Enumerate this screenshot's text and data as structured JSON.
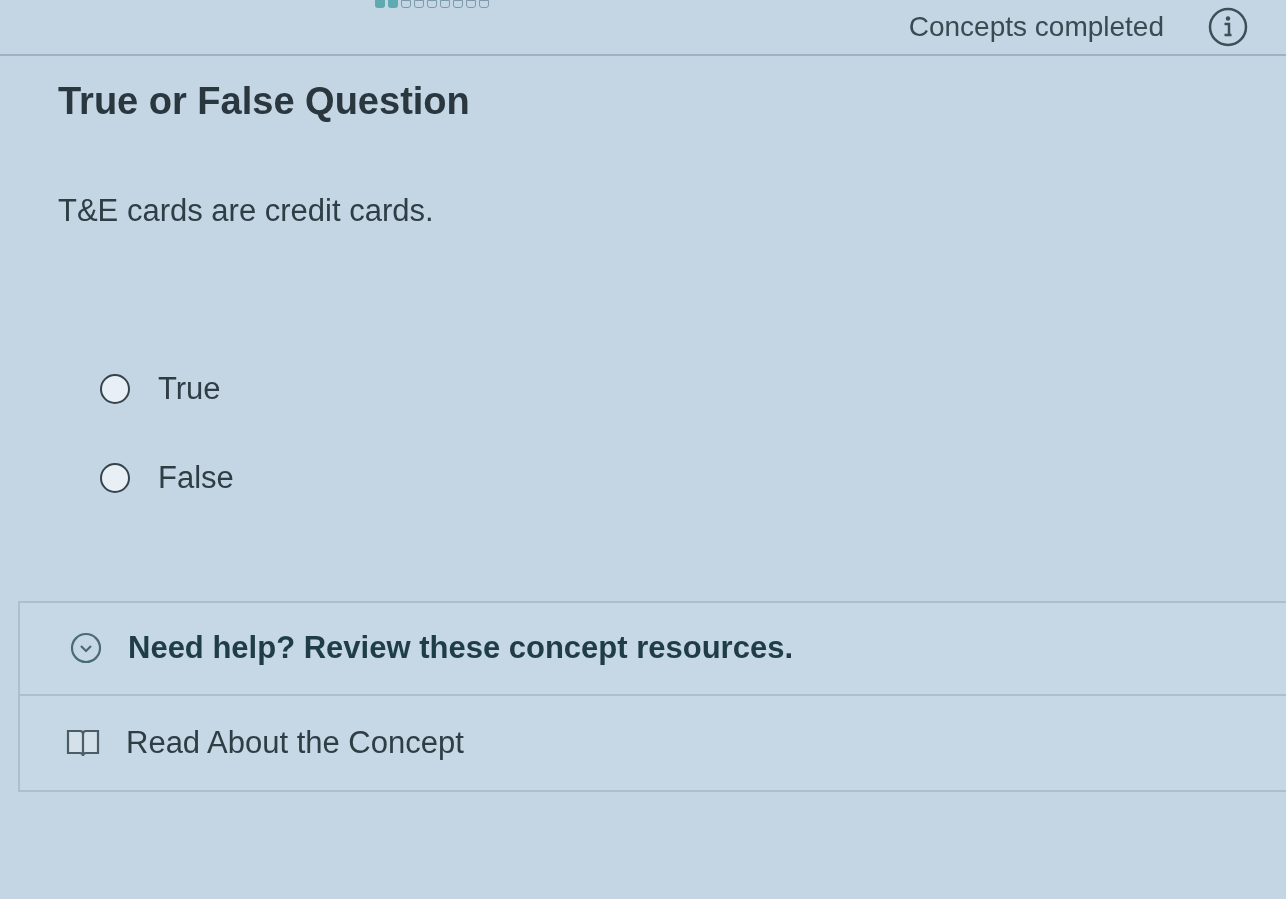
{
  "header": {
    "progress_text": "Concepts completed"
  },
  "question": {
    "type_label": "True or False Question",
    "prompt": "T&E cards are credit cards."
  },
  "options": [
    {
      "label": "True",
      "selected": false
    },
    {
      "label": "False",
      "selected": false
    }
  ],
  "resources": {
    "heading": "Need help? Review these concept resources.",
    "expanded": true,
    "links": [
      {
        "label": "Read About the Concept"
      }
    ]
  }
}
